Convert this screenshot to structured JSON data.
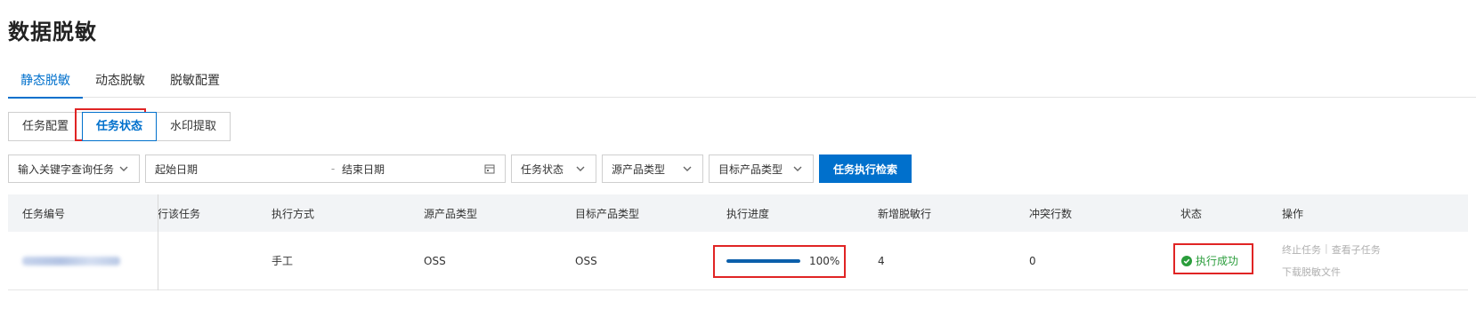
{
  "page": {
    "title": "数据脱敏"
  },
  "tabs": [
    {
      "label": "静态脱敏",
      "active": true
    },
    {
      "label": "动态脱敏",
      "active": false
    },
    {
      "label": "脱敏配置",
      "active": false
    }
  ],
  "subtabs": [
    {
      "label": "任务配置",
      "active": false
    },
    {
      "label": "任务状态",
      "active": true
    },
    {
      "label": "水印提取",
      "active": false
    }
  ],
  "filters": {
    "keyword_placeholder": "输入关键字查询任务",
    "start_date": "起始日期",
    "date_sep": "-",
    "end_date": "结束日期",
    "task_status": "任务状态",
    "source_type": "源产品类型",
    "target_type": "目标产品类型",
    "search_button": "任务执行检索"
  },
  "table": {
    "headers": [
      "任务编号",
      "行该任务",
      "执行方式",
      "源产品类型",
      "目标产品类型",
      "执行进度",
      "新增脱敏行",
      "冲突行数",
      "状态",
      "操作"
    ],
    "rows": [
      {
        "task_id": "",
        "method": "手工",
        "source_type": "OSS",
        "target_type": "OSS",
        "progress": 1.0,
        "progress_label": "100%",
        "new_rows": "4",
        "conflict_rows": "0",
        "status": "执行成功",
        "actions": {
          "stop": "终止任务",
          "sep": "|",
          "view_sub": "查看子任务",
          "download": "下载脱敏文件"
        }
      }
    ]
  },
  "colors": {
    "accent": "#0070cc",
    "success": "#2a9d3b",
    "highlight": "#e02424"
  }
}
